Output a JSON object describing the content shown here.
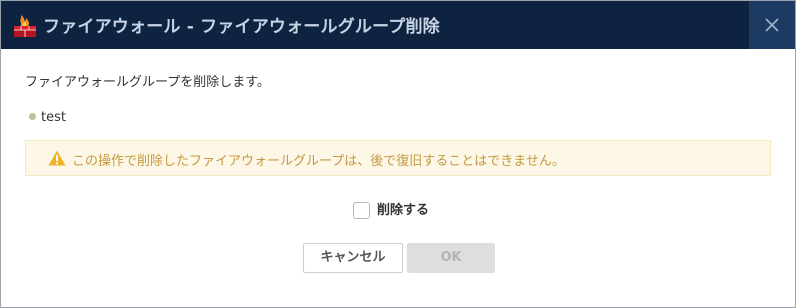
{
  "dialog": {
    "title": "ファイアウォール - ファイアウォールグループ削除",
    "title_icon": "firewall-icon",
    "close_icon": "close-icon"
  },
  "body": {
    "description": "ファイアウォールグループを削除します。",
    "items": [
      "test"
    ],
    "warning": {
      "icon": "warning-triangle-icon",
      "text": "この操作で削除したファイアウォールグループは、後で復旧することはできません。"
    },
    "confirm": {
      "label": "削除する",
      "checked": false
    }
  },
  "buttons": {
    "cancel_label": "キャンセル",
    "ok_label": "OK",
    "ok_enabled": false
  },
  "colors": {
    "titlebar": "#0e2340",
    "close_button": "#1d3a63",
    "warning_background": "#fdf7e7",
    "warning_text": "#c59a3f",
    "warning_icon": "#f0b429",
    "bullet": "#c2bf9a"
  }
}
